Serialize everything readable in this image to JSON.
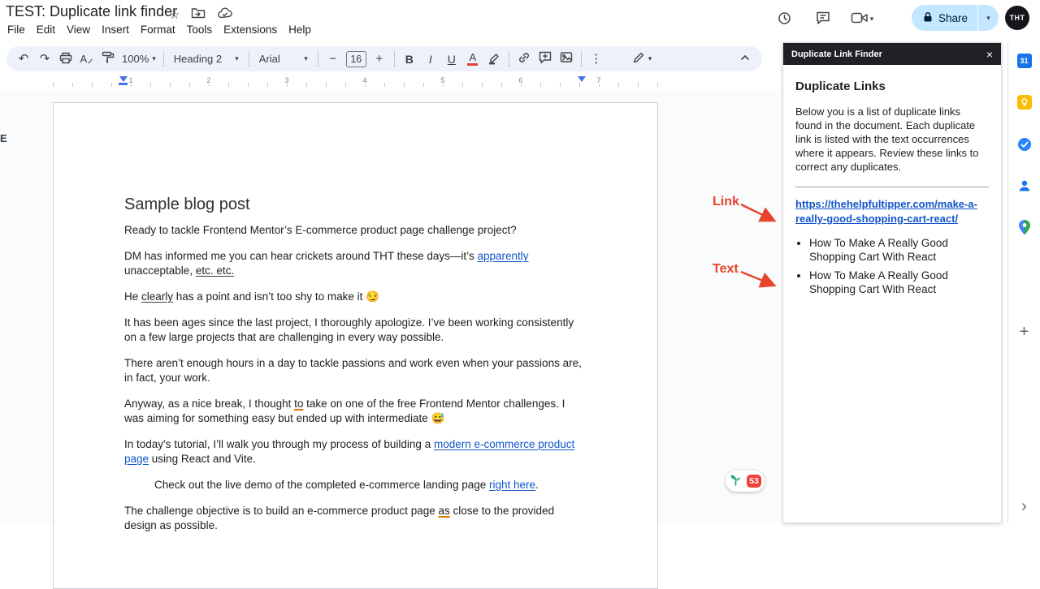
{
  "titlebar": {
    "title": "TEST: Duplicate link finder",
    "menus": [
      "File",
      "Edit",
      "View",
      "Insert",
      "Format",
      "Tools",
      "Extensions",
      "Help"
    ],
    "share": "Share",
    "avatar": "THT"
  },
  "toolbar": {
    "zoom": "100%",
    "style": "Heading 2",
    "font": "Arial",
    "size": "16"
  },
  "ruler": {
    "marks": [
      "1",
      "2",
      "3",
      "4",
      "5",
      "6",
      "7"
    ]
  },
  "doc": {
    "heading": "Sample blog post",
    "p1": "Ready to tackle Frontend Mentor’s E-commerce product page challenge project?",
    "p2a": "DM has informed me you can hear crickets around THT these days—it’s ",
    "p2b": "apparently",
    "p2c": " unacceptable, ",
    "p2d": "etc. etc.",
    "p3a": "He ",
    "p3b": "clearly",
    "p3c": " has a point and isn’t too shy to make it ",
    "p3emoji": "😏",
    "p4": "It has been ages since the last project, I thoroughly apologize. I’ve been working consistently on a few large projects that are challenging in every way possible.",
    "p5": "There aren’t enough hours in a day to tackle passions and work even when your passions are, in fact, your work.",
    "p6a": "Anyway, as a nice break, I thought ",
    "p6b": "to",
    "p6c": " take on one of the free Frontend Mentor challenges. I was aiming for something easy but ended up with intermediate ",
    "p6emoji": "😅",
    "p7a": "In today’s tutorial, I’ll walk you through my process of building a ",
    "p7b": "modern e-commerce product page",
    "p7c": " using React and Vite.",
    "p8a": "Check out the live demo of the completed e-commerce landing page ",
    "p8b": "right here",
    "p8c": ".",
    "p9a": "The challenge objective is to build an e-commerce product page ",
    "p9b": "as",
    "p9c": " close to the provided design as possible."
  },
  "panel": {
    "title": "Duplicate Link Finder",
    "heading": "Duplicate Links",
    "description": "Below you is a list of duplicate links found in the document. Each duplicate link is listed with the text occurrences where it appears. Review these links to correct any duplicates.",
    "link": "https://thehelpfultipper.com/make-a-really-good-shopping-cart-react/",
    "occurrences": [
      "How To Make A Really Good Shopping Cart With React",
      "How To Make A Really Good Shopping Cart With React"
    ]
  },
  "annotations": {
    "link": "Link",
    "text": "Text"
  },
  "badge": {
    "count": "53"
  },
  "misc": {
    "left_edge": "E"
  },
  "colors": {
    "toolbar_bg": "#edf2fa",
    "share_bg": "#c2e7ff",
    "panel_header_bg": "#202124",
    "link_blue": "#1155cc",
    "annotation_red": "#e8432b",
    "badge_red": "#ee4237"
  }
}
